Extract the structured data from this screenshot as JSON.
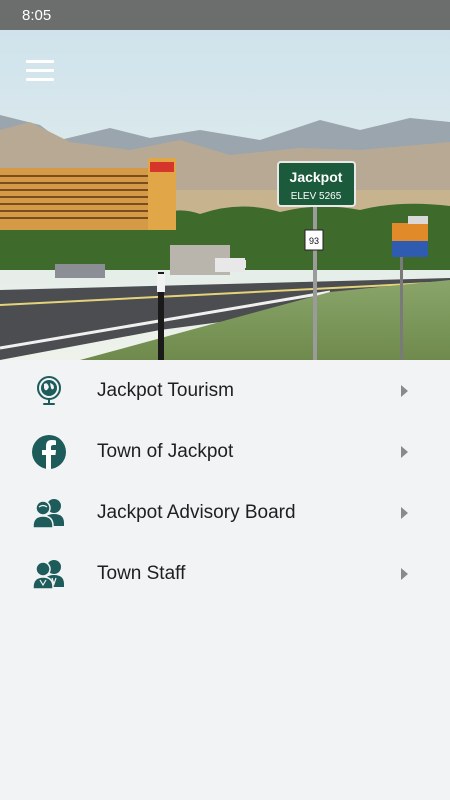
{
  "status_bar": {
    "time": "8:05"
  },
  "header": {
    "menu_icon": "hamburger-icon"
  },
  "hero": {
    "sign_title": "Jackpot",
    "sign_subtitle": "ELEV 5265",
    "route_number": "93"
  },
  "menu": {
    "items": [
      {
        "label": "Jackpot Tourism",
        "icon": "globe-icon"
      },
      {
        "label": "Town of Jackpot",
        "icon": "facebook-icon"
      },
      {
        "label": "Jackpot Advisory Board",
        "icon": "people-group-icon"
      },
      {
        "label": "Town Staff",
        "icon": "staff-group-icon"
      }
    ]
  },
  "colors": {
    "accent": "#1d5c5a",
    "background": "#f2f3f5",
    "status_bar": "#6c6e6d"
  }
}
